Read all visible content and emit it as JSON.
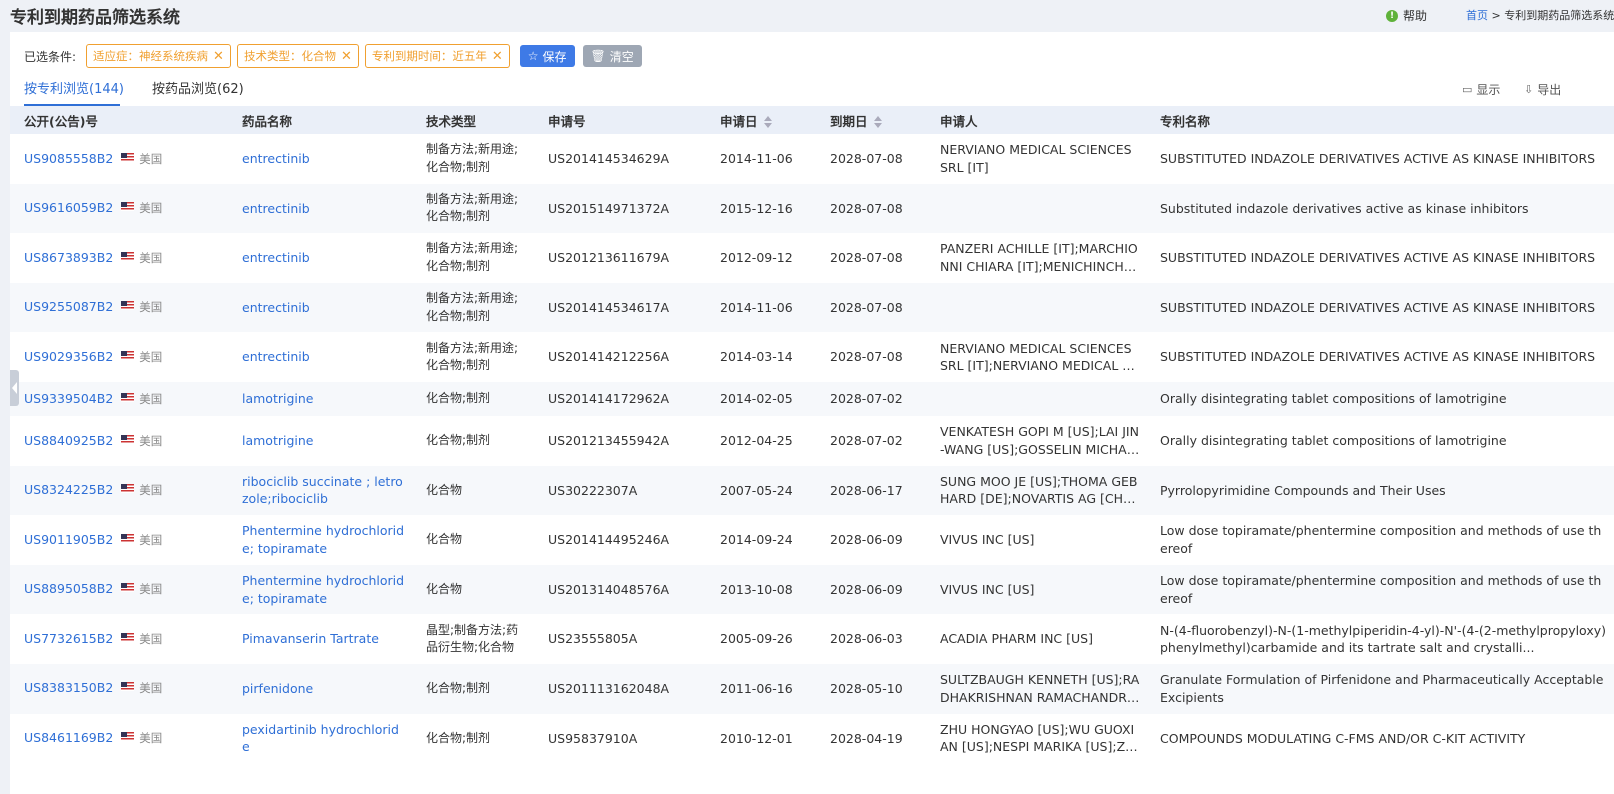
{
  "header": {
    "title": "专利到期药品筛选系统",
    "help": "帮助",
    "breadcrumb_home": "首页",
    "breadcrumb_sep": " > ",
    "breadcrumb_current": "专利到期药品筛选系统"
  },
  "filters": {
    "label": "已选条件:",
    "tags": [
      "适应症：神经系统疾病",
      "技术类型：化合物",
      "专利到期时间：近五年"
    ],
    "save": "保存",
    "clear": "清空"
  },
  "tabs": [
    "按专利浏览(144)",
    "按药品浏览(62)"
  ],
  "tools": {
    "display": "显示",
    "export": "导出"
  },
  "columns": [
    "公开(公告)号",
    "药品名称",
    "技术类型",
    "申请号",
    "申请日",
    "到期日",
    "申请人",
    "专利名称"
  ],
  "rows": [
    {
      "pub": "US9085558B2",
      "country": "美国",
      "drug": "entrectinib",
      "tech": "制备方法;新用途;化合物;制剂",
      "app_no": "US201414534629A",
      "app_date": "2014-11-06",
      "exp_date": "2028-07-08",
      "applicant": "NERVIANO MEDICAL SCIENCES SRL [IT]",
      "title": "SUBSTITUTED INDAZOLE DERIVATIVES ACTIVE AS KINASE INHIBITORS"
    },
    {
      "pub": "US9616059B2",
      "country": "美国",
      "drug": "entrectinib",
      "tech": "制备方法;新用途;化合物;制剂",
      "app_no": "US201514971372A",
      "app_date": "2015-12-16",
      "exp_date": "2028-07-08",
      "applicant": "",
      "title": "Substituted indazole derivatives active as kinase inhibitors"
    },
    {
      "pub": "US8673893B2",
      "country": "美国",
      "drug": "entrectinib",
      "tech": "制备方法;新用途;化合物;制剂",
      "app_no": "US201213611679A",
      "app_date": "2012-09-12",
      "exp_date": "2028-07-08",
      "applicant": "PANZERI ACHILLE [IT];MARCHIONNI CHIARA [IT];MENICHINCHERI...",
      "title": "SUBSTITUTED INDAZOLE DERIVATIVES ACTIVE AS KINASE INHIBITORS"
    },
    {
      "pub": "US9255087B2",
      "country": "美国",
      "drug": "entrectinib",
      "tech": "制备方法;新用途;化合物;制剂",
      "app_no": "US201414534617A",
      "app_date": "2014-11-06",
      "exp_date": "2028-07-08",
      "applicant": "",
      "title": "SUBSTITUTED INDAZOLE DERIVATIVES ACTIVE AS KINASE INHIBITORS"
    },
    {
      "pub": "US9029356B2",
      "country": "美国",
      "drug": "entrectinib",
      "tech": "制备方法;新用途;化合物;制剂",
      "app_no": "US201414212256A",
      "app_date": "2014-03-14",
      "exp_date": "2028-07-08",
      "applicant": "NERVIANO MEDICAL SCIENCES SRL [IT];NERVIANO MEDICAL SER...",
      "title": "SUBSTITUTED INDAZOLE DERIVATIVES ACTIVE AS KINASE INHIBITORS"
    },
    {
      "pub": "US9339504B2",
      "country": "美国",
      "drug": "lamotrigine",
      "tech": "化合物;制剂",
      "app_no": "US201414172962A",
      "app_date": "2014-02-05",
      "exp_date": "2028-07-02",
      "applicant": "",
      "title": "Orally disintegrating tablet compositions of lamotrigine"
    },
    {
      "pub": "US8840925B2",
      "country": "美国",
      "drug": "lamotrigine",
      "tech": "化合物;制剂",
      "app_no": "US201213455942A",
      "app_date": "2012-04-25",
      "exp_date": "2028-07-02",
      "applicant": "VENKATESH GOPI M [US];LAI JIN-WANG [US];GOSSELIN MICHAEL...",
      "title": "Orally disintegrating tablet compositions of lamotrigine"
    },
    {
      "pub": "US8324225B2",
      "country": "美国",
      "drug": "ribociclib succinate ; letrozole;ribociclib",
      "tech": "化合物",
      "app_no": "US30222307A",
      "app_date": "2007-05-24",
      "exp_date": "2028-06-17",
      "applicant": "SUNG MOO JE [US];THOMA GEBHARD [DE];NOVARTIS AG [CH];AS...",
      "title": "Pyrrolopyrimidine Compounds and Their Uses"
    },
    {
      "pub": "US9011905B2",
      "country": "美国",
      "drug": "Phentermine hydrochloride; topiramate",
      "tech": "化合物",
      "app_no": "US201414495246A",
      "app_date": "2014-09-24",
      "exp_date": "2028-06-09",
      "applicant": "VIVUS INC [US]",
      "title": "Low dose topiramate/phentermine composition and methods of use thereof"
    },
    {
      "pub": "US8895058B2",
      "country": "美国",
      "drug": "Phentermine hydrochloride; topiramate",
      "tech": "化合物",
      "app_no": "US201314048576A",
      "app_date": "2013-10-08",
      "exp_date": "2028-06-09",
      "applicant": "VIVUS INC [US]",
      "title": "Low dose topiramate/phentermine composition and methods of use thereof"
    },
    {
      "pub": "US7732615B2",
      "country": "美国",
      "drug": "Pimavanserin Tartrate",
      "tech": "晶型;制备方法;药品衍生物;化合物",
      "app_no": "US23555805A",
      "app_date": "2005-09-26",
      "exp_date": "2028-06-03",
      "applicant": "ACADIA PHARM INC [US]",
      "title": "N-(4-fluorobenzyl)-N-(1-methylpiperidin-4-yl)-N'-(4-(2-methylpropyloxy)phenylmethyl)carbamide and its tartrate salt and crystalli..."
    },
    {
      "pub": "US8383150B2",
      "country": "美国",
      "drug": "pirfenidone",
      "tech": "化合物;制剂",
      "app_no": "US201113162048A",
      "app_date": "2011-06-16",
      "exp_date": "2028-05-10",
      "applicant": "SULTZBAUGH KENNETH [US];RADHAKRISHNAN RAMACHANDRA...",
      "title": "Granulate Formulation of Pirfenidone and Pharmaceutically Acceptable Excipients"
    },
    {
      "pub": "US8461169B2",
      "country": "美国",
      "drug": "pexidartinib hydrochloride",
      "tech": "化合物;制剂",
      "app_no": "US95837910A",
      "app_date": "2010-12-01",
      "exp_date": "2028-04-19",
      "applicant": "ZHU HONGYAO [US];WU GUOXIAN [US];NESPI MARIKA [US];ZHA...",
      "title": "COMPOUNDS MODULATING C-FMS AND/OR C-KIT ACTIVITY"
    }
  ]
}
